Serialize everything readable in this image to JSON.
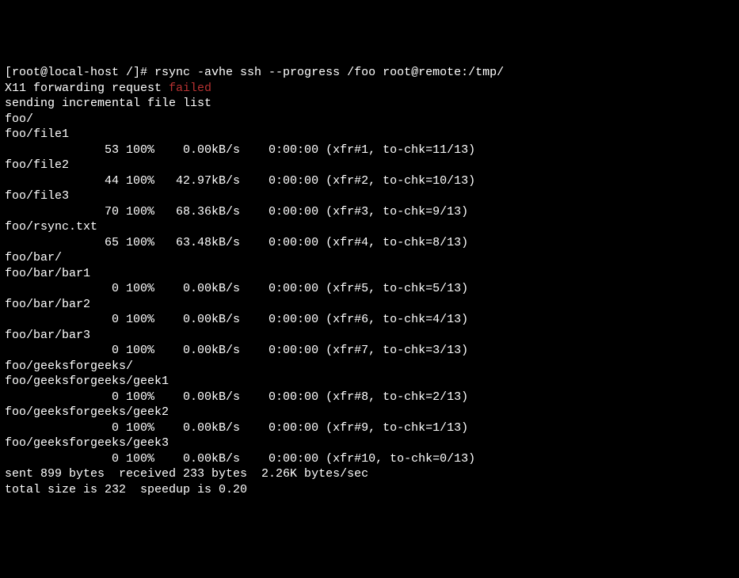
{
  "prompt": {
    "userhost": "[root@local-host /]# ",
    "command": "rsync -avhe ssh --progress /foo root@remote:/tmp/"
  },
  "x11_prefix": "X11 forwarding request ",
  "x11_failed": "failed",
  "sending": "sending incremental file list",
  "entries": [
    {
      "name": "foo/",
      "progress": null
    },
    {
      "name": "foo/file1",
      "progress": {
        "bytes": "53",
        "pct": "100%",
        "rate": "0.00kB/s",
        "eta": "0:00:00",
        "xfr": "(xfr#1, to-chk=11/13)"
      }
    },
    {
      "name": "foo/file2",
      "progress": {
        "bytes": "44",
        "pct": "100%",
        "rate": "42.97kB/s",
        "eta": "0:00:00",
        "xfr": "(xfr#2, to-chk=10/13)"
      }
    },
    {
      "name": "foo/file3",
      "progress": {
        "bytes": "70",
        "pct": "100%",
        "rate": "68.36kB/s",
        "eta": "0:00:00",
        "xfr": "(xfr#3, to-chk=9/13)"
      }
    },
    {
      "name": "foo/rsync.txt",
      "progress": {
        "bytes": "65",
        "pct": "100%",
        "rate": "63.48kB/s",
        "eta": "0:00:00",
        "xfr": "(xfr#4, to-chk=8/13)"
      }
    },
    {
      "name": "foo/bar/",
      "progress": null
    },
    {
      "name": "foo/bar/bar1",
      "progress": {
        "bytes": "0",
        "pct": "100%",
        "rate": "0.00kB/s",
        "eta": "0:00:00",
        "xfr": "(xfr#5, to-chk=5/13)"
      }
    },
    {
      "name": "foo/bar/bar2",
      "progress": {
        "bytes": "0",
        "pct": "100%",
        "rate": "0.00kB/s",
        "eta": "0:00:00",
        "xfr": "(xfr#6, to-chk=4/13)"
      }
    },
    {
      "name": "foo/bar/bar3",
      "progress": {
        "bytes": "0",
        "pct": "100%",
        "rate": "0.00kB/s",
        "eta": "0:00:00",
        "xfr": "(xfr#7, to-chk=3/13)"
      }
    },
    {
      "name": "foo/geeksforgeeks/",
      "progress": null
    },
    {
      "name": "foo/geeksforgeeks/geek1",
      "progress": {
        "bytes": "0",
        "pct": "100%",
        "rate": "0.00kB/s",
        "eta": "0:00:00",
        "xfr": "(xfr#8, to-chk=2/13)"
      }
    },
    {
      "name": "foo/geeksforgeeks/geek2",
      "progress": {
        "bytes": "0",
        "pct": "100%",
        "rate": "0.00kB/s",
        "eta": "0:00:00",
        "xfr": "(xfr#9, to-chk=1/13)"
      }
    },
    {
      "name": "foo/geeksforgeeks/geek3",
      "progress": {
        "bytes": "0",
        "pct": "100%",
        "rate": "0.00kB/s",
        "eta": "0:00:00",
        "xfr": "(xfr#10, to-chk=0/13)"
      }
    }
  ],
  "blank": "",
  "summary_sent": "sent 899 bytes  received 233 bytes  2.26K bytes/sec",
  "summary_total": "total size is 232  speedup is 0.20"
}
